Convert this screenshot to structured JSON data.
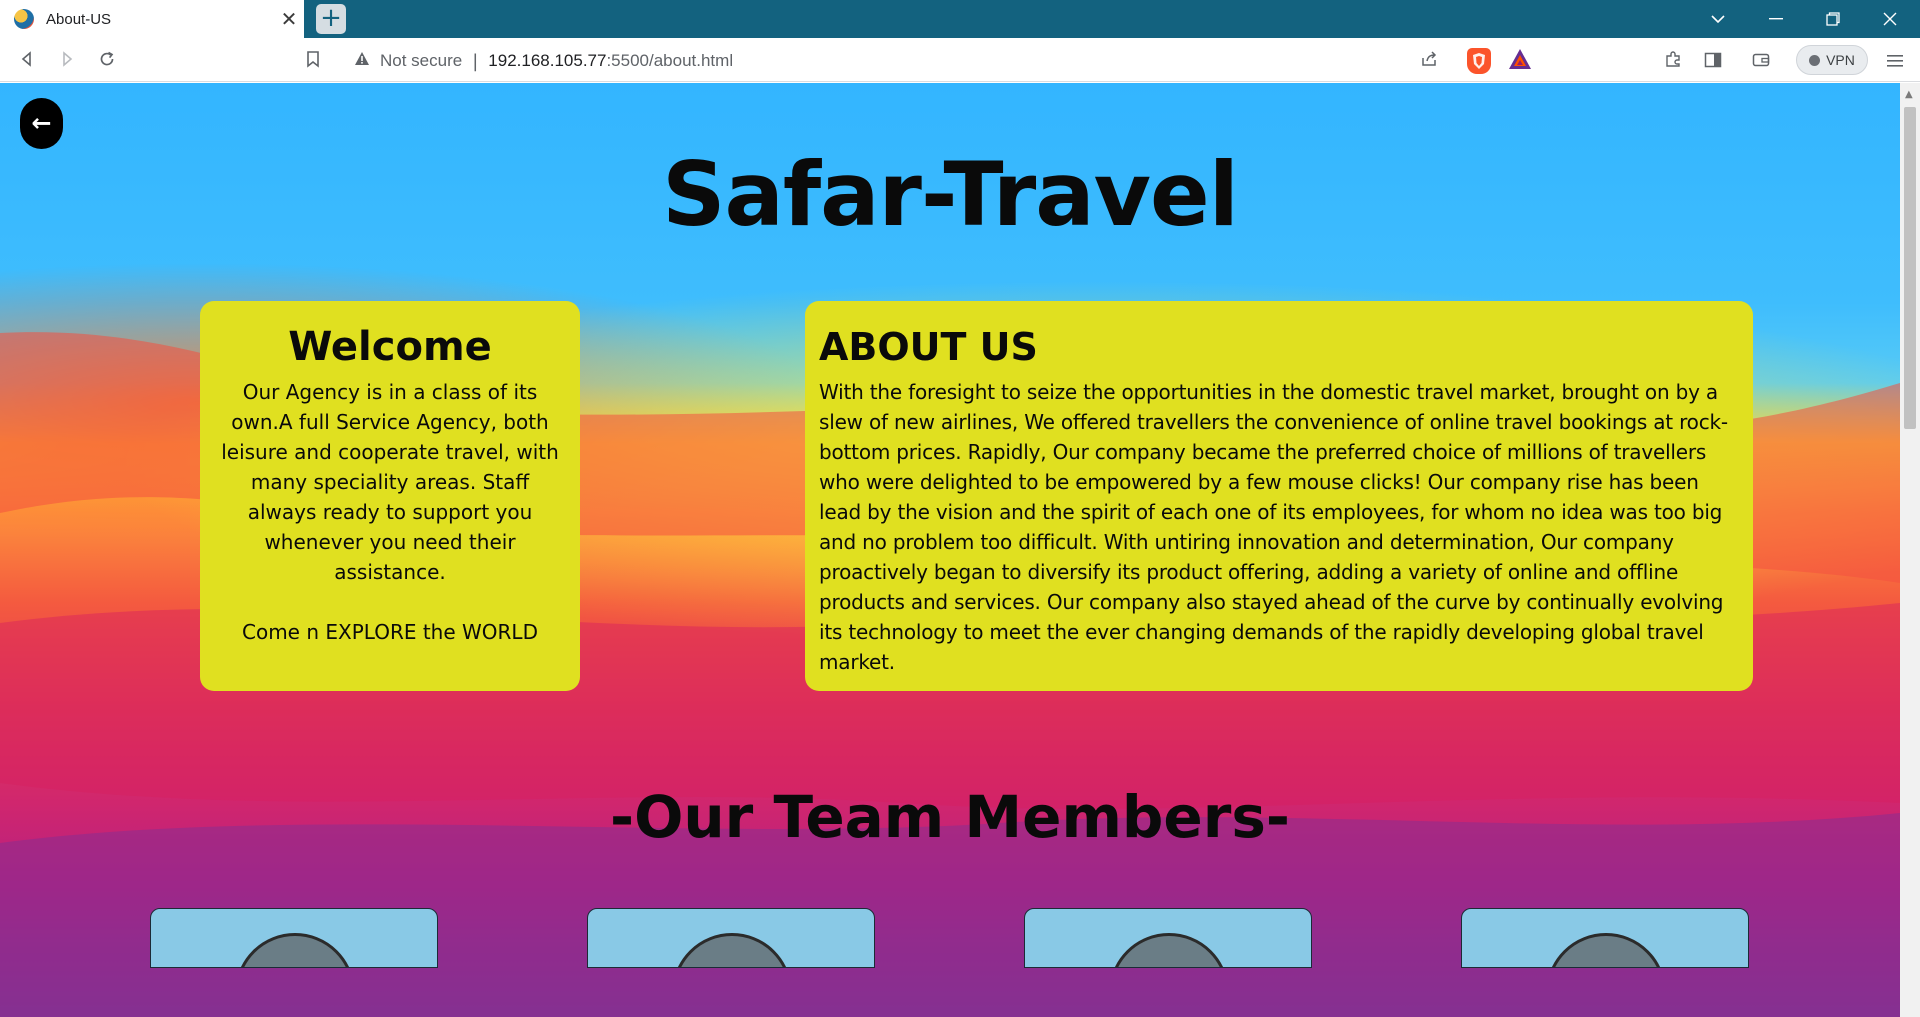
{
  "browser": {
    "tab_title": "About-US",
    "tab_close": "✕",
    "new_tab": "+",
    "security_label": "Not secure",
    "url_host": "192.168.105.77",
    "url_path": ":5500/about.html",
    "vpn_label": "VPN"
  },
  "page": {
    "back_icon": "←",
    "site_title": "Safar-Travel",
    "welcome": {
      "heading": "Welcome",
      "body": "Our Agency is in a class of its own.A full Service Agency, both leisure and cooperate travel, with many speciality areas. Staff always ready to support you whenever you need their assistance.",
      "tagline": "Come n EXPLORE the WORLD"
    },
    "about": {
      "heading": "ABOUT US",
      "body": "With the foresight to seize the opportunities in the domestic travel market, brought on by a slew of new airlines, We offered travellers the convenience of online travel bookings at rock-bottom prices. Rapidly, Our company became the preferred choice of millions of travellers who were delighted to be empowered by a few mouse clicks! Our company rise has been lead by the vision and the spirit of each one of its employees, for whom no idea was too big and no problem too difficult. With untiring innovation and determination, Our company proactively began to diversify its product offering, adding a variety of online and offline products and services. Our company also stayed ahead of the curve by continually evolving its technology to meet the ever changing demands of the rapidly developing global travel market."
    },
    "team_title": "-Our Team Members-"
  },
  "colors": {
    "chrome_tabbar": "#13627f",
    "card_background": "#e0e020",
    "member_card": "#89c9e6",
    "sky": "#33b5ff"
  }
}
